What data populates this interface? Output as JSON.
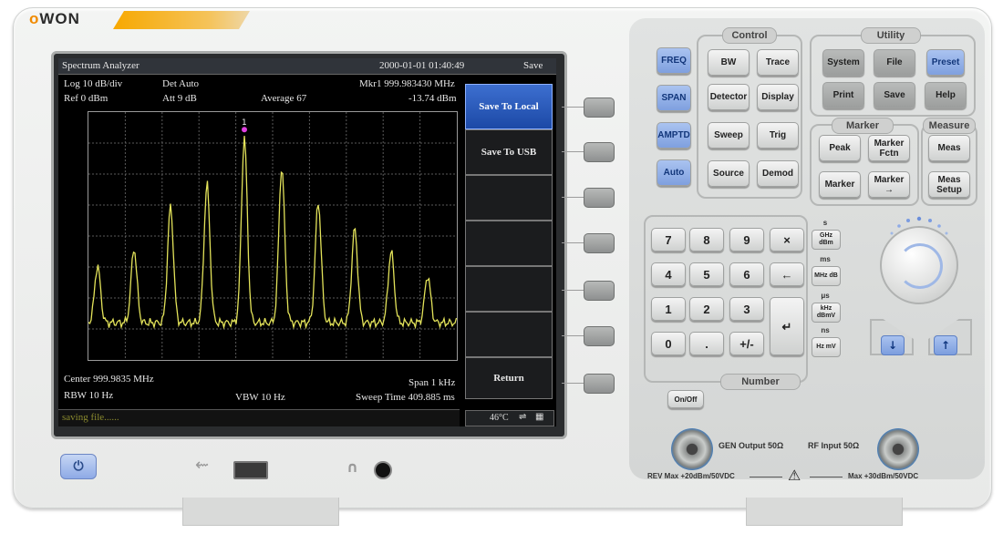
{
  "brand": {
    "logo_o": "o",
    "logo_rest": "WON"
  },
  "screen": {
    "mode": "Spectrum Analyzer",
    "datetime": "2000-01-01 01:40:49",
    "menu_title": "Save",
    "scale": "Log 10 dB/div",
    "detector": "Det Auto",
    "marker": "Mkr1 999.983430 MHz",
    "ref": "Ref 0 dBm",
    "atten": "Att 9 dB",
    "average": "Average 67",
    "marker_level": "-13.74 dBm",
    "center": "Center 999.9835 MHz",
    "span": "Span 1 kHz",
    "rbw": "RBW 10 Hz",
    "vbw": "VBW 10 Hz",
    "sweep": "Sweep Time 409.885 ms",
    "status": "saving file......",
    "temperature": "46°C",
    "marker_number": "1",
    "trace_color": "#e3e35a",
    "softkeys": [
      {
        "label": "Save To Local",
        "active": true
      },
      {
        "label": "Save To USB",
        "active": false
      },
      {
        "label": "",
        "active": false
      },
      {
        "label": "",
        "active": false
      },
      {
        "label": "",
        "active": false
      },
      {
        "label": "",
        "active": false
      },
      {
        "label": "Return",
        "active": false
      }
    ]
  },
  "panel": {
    "groups": {
      "control": "Control",
      "utility": "Utility",
      "marker": "Marker",
      "measure": "Measure",
      "number": "Number"
    },
    "left_keys": [
      "FREQ",
      "SPAN",
      "AMPTD",
      "Auto"
    ],
    "control_keys": [
      "BW",
      "Trace",
      "Detector",
      "Display",
      "Sweep",
      "Trig",
      "Source",
      "Demod"
    ],
    "utility_keys": [
      "System",
      "File",
      "Preset",
      "Print",
      "Save",
      "Help"
    ],
    "marker_keys": [
      "Peak",
      "Marker Fctn",
      "Marker",
      "Marker →"
    ],
    "measure_keys": [
      "Meas",
      "Meas Setup"
    ],
    "number_keys": [
      "7",
      "8",
      "9",
      "×",
      "4",
      "5",
      "6",
      "←",
      "1",
      "2",
      "3",
      "0",
      ".",
      "+/-"
    ],
    "enter_key": "↵",
    "units": [
      {
        "top": "s",
        "key": "GHz dBm"
      },
      {
        "top": "ms",
        "key": "MHz dB"
      },
      {
        "top": "μs",
        "key": "kHz dBmV"
      },
      {
        "top": "ns",
        "key": "Hz mV"
      }
    ],
    "arrow_down": "↓",
    "arrow_up": "↑",
    "onoff": "On/Off",
    "gen_output": "GEN Output 50Ω",
    "rf_input": "RF Input 50Ω",
    "rev_max": "REV Max +20dBm/50VDC",
    "max_in": "Max +30dBm/50VDC",
    "warning_icon": "⚠"
  },
  "front": {
    "power_icon": "⏻",
    "usb_icon": "⇜",
    "headphone_icon": "∩"
  }
}
